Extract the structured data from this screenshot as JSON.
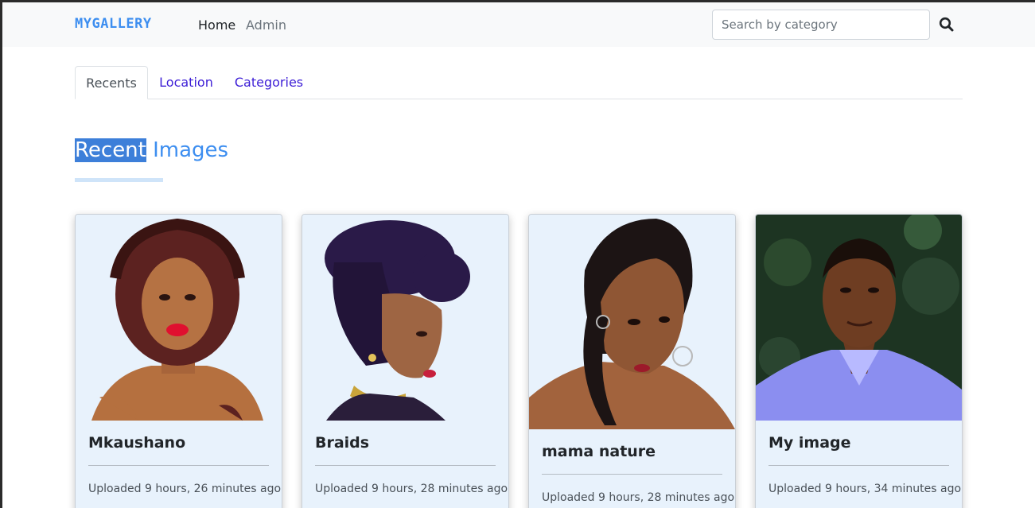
{
  "navbar": {
    "brand": "MYGALLERY",
    "links": [
      "Home",
      "Admin"
    ],
    "search_placeholder": "Search by category",
    "search_icon": "search-icon"
  },
  "tabs": [
    "Recents",
    "Location",
    "Categories"
  ],
  "active_tab": "Recents",
  "section": {
    "title_highlight": "Recent",
    "title_rest": " Images"
  },
  "cards": [
    {
      "title": "Mkaushano",
      "meta": "Uploaded 9 hours, 26 minutes ago"
    },
    {
      "title": "Braids",
      "meta": "Uploaded 9 hours, 28 minutes ago"
    },
    {
      "title": "mama nature",
      "meta": "Uploaded 9 hours, 28 minutes ago"
    },
    {
      "title": "My image",
      "meta": "Uploaded 9 hours, 34 minutes ago"
    }
  ],
  "colors": {
    "brand": "#3d8ef0",
    "tab_link": "#3d1ed6",
    "card_bg": "#e8f2fc",
    "title_highlight_bg": "#3d7fd9"
  }
}
